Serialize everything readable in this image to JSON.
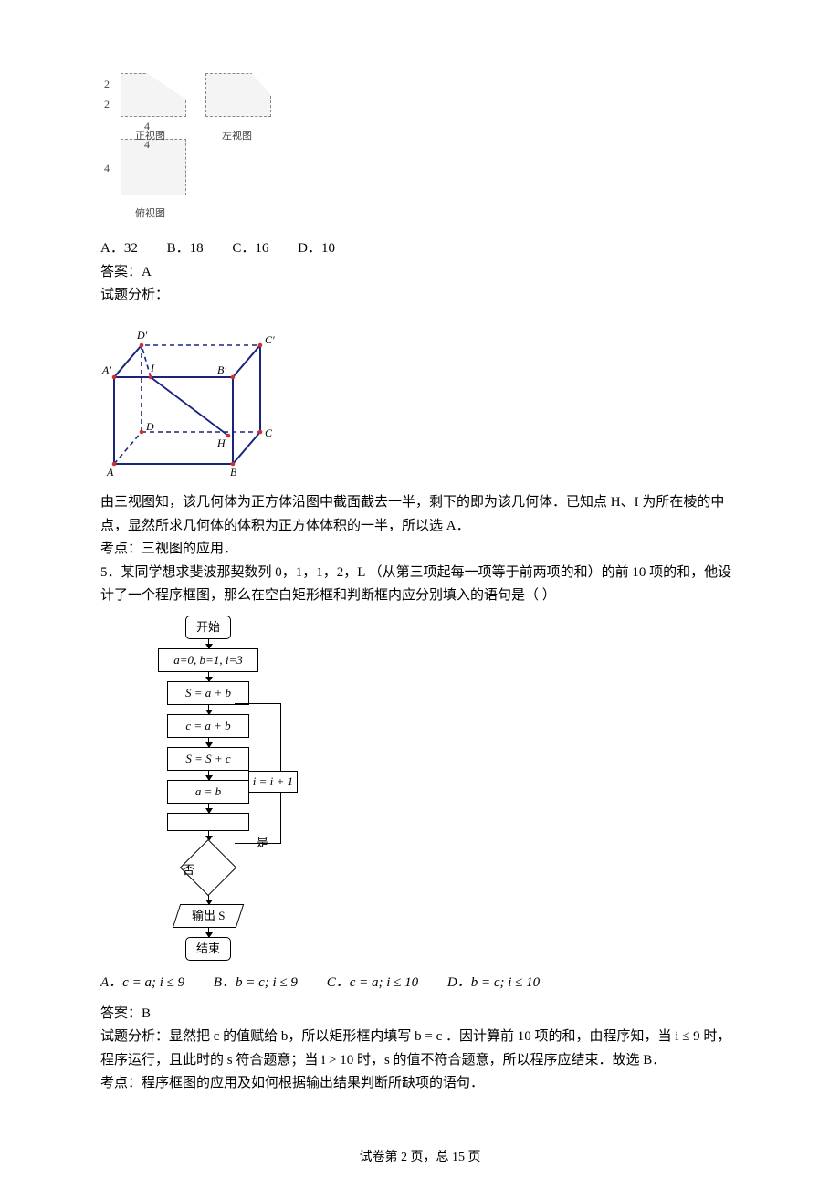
{
  "q4": {
    "tv_dims": {
      "h1": "2",
      "h2": "2",
      "w1": "4",
      "w2": "4",
      "w3": "4"
    },
    "tv_captions": {
      "front": "正视图",
      "side": "左视图",
      "top": "俯视图"
    },
    "options": {
      "A": "A．32",
      "B": "B．18",
      "C": "C．16",
      "D": "D．10"
    },
    "answer_label": "答案：A",
    "analysis_label": "试题分析：",
    "cube_labels": [
      "A",
      "B",
      "C",
      "D",
      "A'",
      "B'",
      "C'",
      "D'",
      "H",
      "I"
    ],
    "explain1": "由三视图知，该几何体为正方体沿图中截面截去一半，剩下的即为该几何体．已知点 H、I 为所在棱的中点，显然所求几何体的体积为正方体体积的一半，所以选 A．",
    "kaodian": "考点：三视图的应用．"
  },
  "q5": {
    "stem": "5．某同学想求斐波那契数列 0，1，1，2，L （从第三项起每一项等于前两项的和）的前 10 项的和，他设计了一个程序框图，那么在空白矩形框和判断框内应分别填入的语句是（    ）",
    "flow": {
      "start": "开始",
      "init": "a=0, b=1, i=3",
      "s1": "S = a + b",
      "c": "c = a + b",
      "s2": "S = S + c",
      "ab": "a = b",
      "inc": "i = i + 1",
      "out": "输出 S",
      "end": "结束",
      "yes": "是",
      "no": "否"
    },
    "options": {
      "A": "A．c = a; i ≤ 9",
      "B": "B．b = c; i ≤ 9",
      "C": "C．c = a; i ≤ 10",
      "D": "D．b = c; i ≤ 10"
    },
    "answer_label": "答案：B",
    "analysis": "试题分析：显然把 c 的值赋给 b，所以矩形框内填写 b = c ．因计算前 10 项的和，由程序知，当 i ≤ 9 时，程序运行，且此时的 s 符合题意；当 i > 10 时，s 的值不符合题意，所以程序应结束．故选 B．",
    "kaodian": "考点：程序框图的应用及如何根据输出结果判断所缺项的语句．"
  },
  "footer": "试卷第 2 页，总 15 页"
}
